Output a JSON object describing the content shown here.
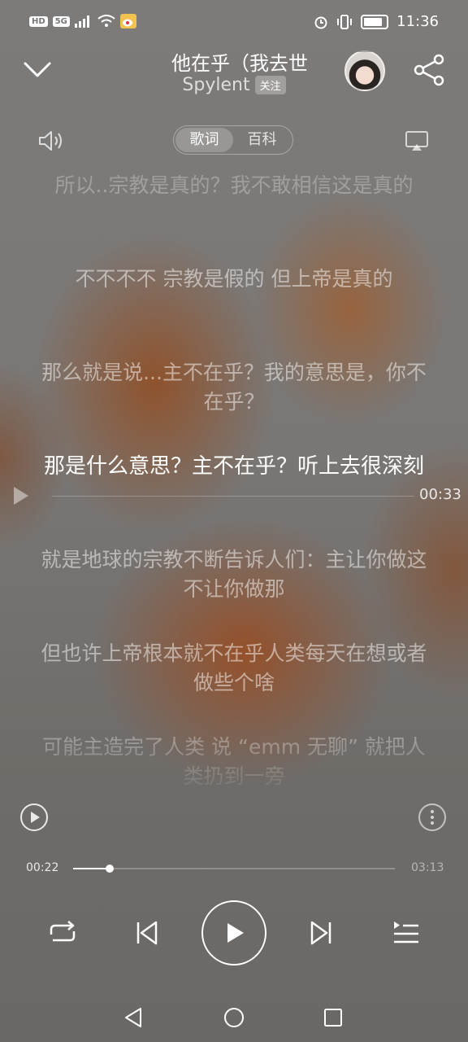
{
  "status_bar": {
    "left_tags": [
      "HD",
      "5G"
    ],
    "time": "11:36"
  },
  "header": {
    "song_title": "他在乎（我去世",
    "artist": "Spylent",
    "follow_label": "关注"
  },
  "tabs": [
    {
      "label": "歌词",
      "active": true
    },
    {
      "label": "百科",
      "active": false
    }
  ],
  "lyrics": [
    {
      "text": "所以..宗教是真的？我不敢相信这是真的",
      "current": false
    },
    {
      "text": "不不不不 宗教是假的 但上帝是真的",
      "current": false
    },
    {
      "text": "那么就是说...主不在乎？我的意思是，你不在乎？",
      "current": false
    },
    {
      "text": "那是什么意思？主不在乎？听上去很深刻",
      "current": true
    },
    {
      "text": "就是地球的宗教不断告诉人们：主让你做这 不让你做那",
      "current": false
    },
    {
      "text": "但也许上帝根本就不在乎人类每天在想或者做些个啥",
      "current": false
    },
    {
      "text": "可能主造完了人类 说 “emm 无聊” 就把人类扔到一旁",
      "current": false
    }
  ],
  "seek_indicator_time": "00:33",
  "player": {
    "current_time": "00:22",
    "total_time": "03:13",
    "progress_fraction": 0.114
  },
  "icons": {
    "collapse": "chevron-down-icon",
    "share": "share-icon",
    "volume": "volume-icon",
    "cast": "cast-icon",
    "repeat": "repeat-icon",
    "prev": "skip-previous-icon",
    "play": "play-icon",
    "next": "skip-next-icon",
    "playlist": "playlist-icon"
  }
}
